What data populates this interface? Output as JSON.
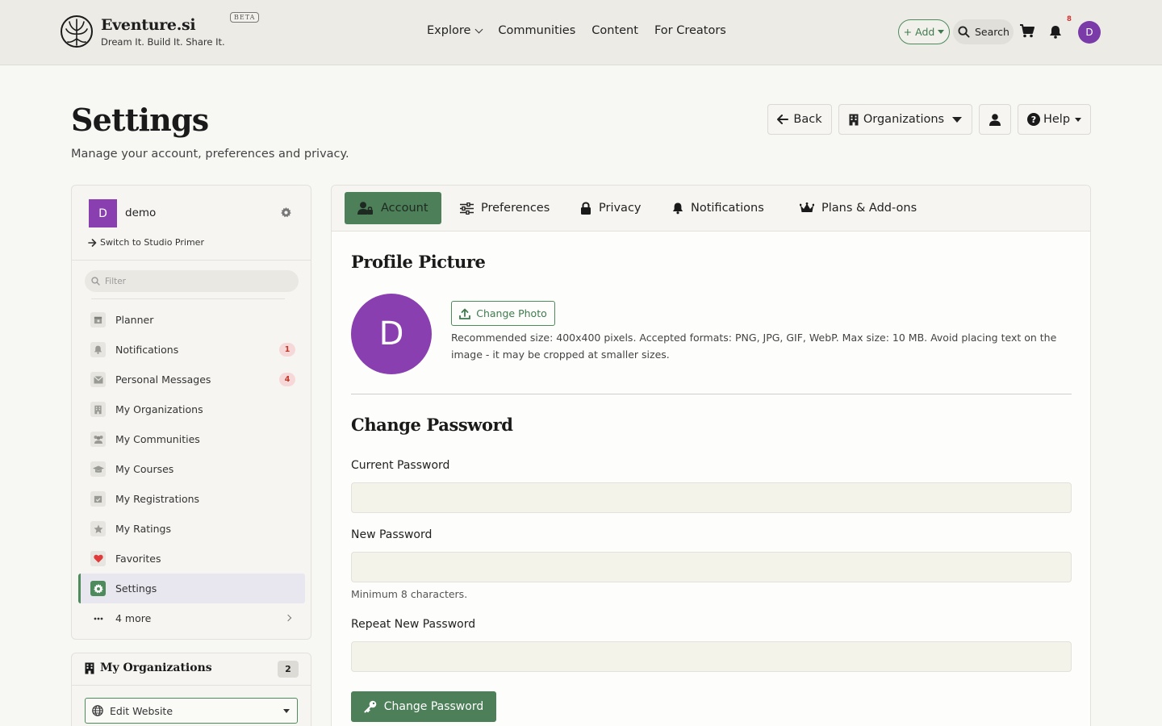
{
  "brand": {
    "name": "Eventure.si",
    "tagline": "Dream It. Build It. Share It.",
    "badge": "BETA"
  },
  "nav": {
    "links": [
      "Explore",
      "Communities",
      "Content",
      "For Creators"
    ],
    "add_label": "+ Add",
    "search_label": "Search",
    "notification_count": "8",
    "user_initial": "D"
  },
  "page": {
    "title": "Settings",
    "subtitle": "Manage your account, preferences and privacy.",
    "back_label": "Back",
    "organizations_label": "Organizations",
    "help_label": "Help"
  },
  "sidebar": {
    "profile_initial": "D",
    "profile_name": "demo",
    "switch_label": "Switch to Studio Primer",
    "filter_placeholder": "Filter",
    "items": [
      {
        "label": "Planner",
        "icon": "calendar-icon"
      },
      {
        "label": "Notifications",
        "icon": "bell-icon",
        "badge": "1"
      },
      {
        "label": "Personal Messages",
        "icon": "envelope-icon",
        "badge": "4"
      },
      {
        "label": "My Organizations",
        "icon": "building-icon"
      },
      {
        "label": "My Communities",
        "icon": "users-icon"
      },
      {
        "label": "My Courses",
        "icon": "graduation-cap-icon"
      },
      {
        "label": "My Registrations",
        "icon": "calendar-check-icon"
      },
      {
        "label": "My Ratings",
        "icon": "star-icon"
      },
      {
        "label": "Favorites",
        "icon": "heart-icon"
      },
      {
        "label": "Settings",
        "icon": "gear-icon",
        "active": true
      },
      {
        "label": "4 more",
        "icon": "ellipsis-icon"
      }
    ]
  },
  "org_panel": {
    "title": "My Organizations",
    "count": "2",
    "select_value": "Edit Website"
  },
  "tabs": [
    {
      "label": "Account",
      "icon": "user-lock-icon",
      "active": true
    },
    {
      "label": "Preferences",
      "icon": "sliders-icon"
    },
    {
      "label": "Privacy",
      "icon": "lock-icon"
    },
    {
      "label": "Notifications",
      "icon": "bell-icon"
    },
    {
      "label": "Plans & Add-ons",
      "icon": "crown-icon"
    }
  ],
  "profile_picture": {
    "title": "Profile Picture",
    "avatar_initial": "D",
    "change_label": "Change Photo",
    "help": "Recommended size: 400x400 pixels. Accepted formats: PNG, JPG, GIF, WebP. Max size: 10 MB. Avoid placing text on the image - it may be cropped at smaller sizes."
  },
  "password": {
    "title": "Change Password",
    "current_label": "Current Password",
    "new_label": "New Password",
    "new_help": "Minimum 8 characters.",
    "repeat_label": "Repeat New Password",
    "submit_label": "Change Password"
  },
  "colors": {
    "accent_green": "#4d7f59",
    "avatar_purple": "#8a3fb0",
    "badge_red": "#c0392b",
    "heart_red": "#e03b3b"
  }
}
